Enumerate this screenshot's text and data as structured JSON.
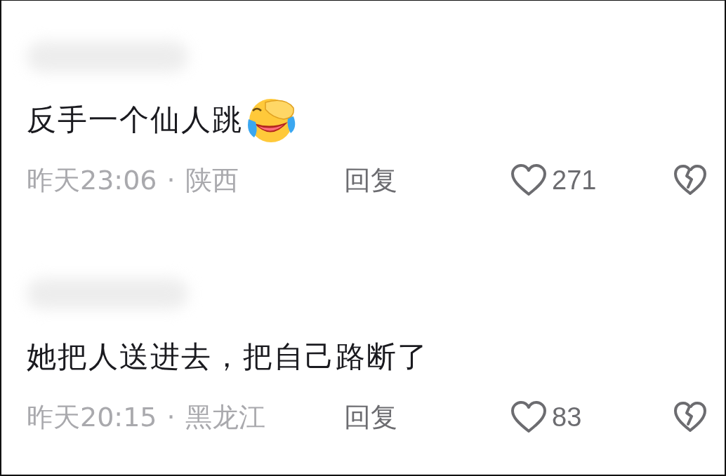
{
  "comments": [
    {
      "text": "反手一个仙人跳",
      "emoji": true,
      "time": "昨天23:06",
      "separator": "·",
      "location": "陕西",
      "reply": "回复",
      "liked": false,
      "likes": "271"
    },
    {
      "text": "她把人送进去，把自己路断了",
      "emoji": false,
      "time": "昨天20:15",
      "separator": "·",
      "location": "黑龙江",
      "reply": "回复",
      "liked": false,
      "likes": "83"
    }
  ]
}
